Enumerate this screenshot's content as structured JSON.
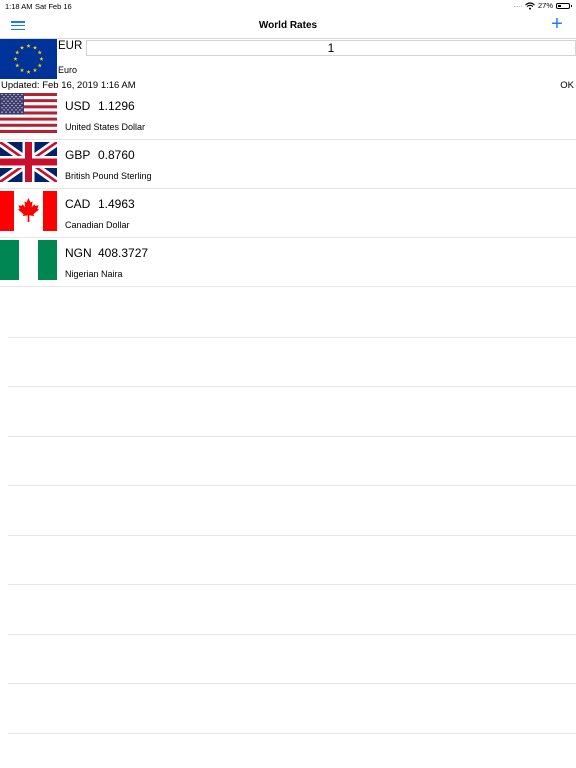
{
  "status_bar": {
    "time": "1:18 AM",
    "date": "Sat Feb 16",
    "signal": ".....",
    "battery": "27%",
    "battery_level": 0.27
  },
  "nav": {
    "title": "World Rates",
    "add_label": "+"
  },
  "base": {
    "code": "EUR",
    "amount": "1",
    "name": "Euro",
    "flag": "eu-flag"
  },
  "updated_text": "Updated: Feb 16, 2019 1:16 AM",
  "ok_label": "OK",
  "rates": [
    {
      "code": "USD",
      "value": "1.1296",
      "name": "United States Dollar",
      "flag": "us-flag"
    },
    {
      "code": "GBP",
      "value": "0.8760",
      "name": "British Pound Sterling",
      "flag": "uk-flag"
    },
    {
      "code": "CAD",
      "value": "1.4963",
      "name": "Canadian Dollar",
      "flag": "canada-flag"
    },
    {
      "code": "NGN",
      "value": "408.3727",
      "name": "Nigerian Naira",
      "flag": "nigeria-flag"
    }
  ],
  "colors": {
    "accent": "#1a7cf5",
    "eu_blue": "#003399",
    "eu_star": "#ffcc00",
    "us_red": "#b22234",
    "us_blue": "#3c3b6e",
    "uk_blue": "#012169",
    "uk_red": "#c8102e",
    "canada_red": "#ff0000",
    "nigeria_green": "#008751"
  }
}
